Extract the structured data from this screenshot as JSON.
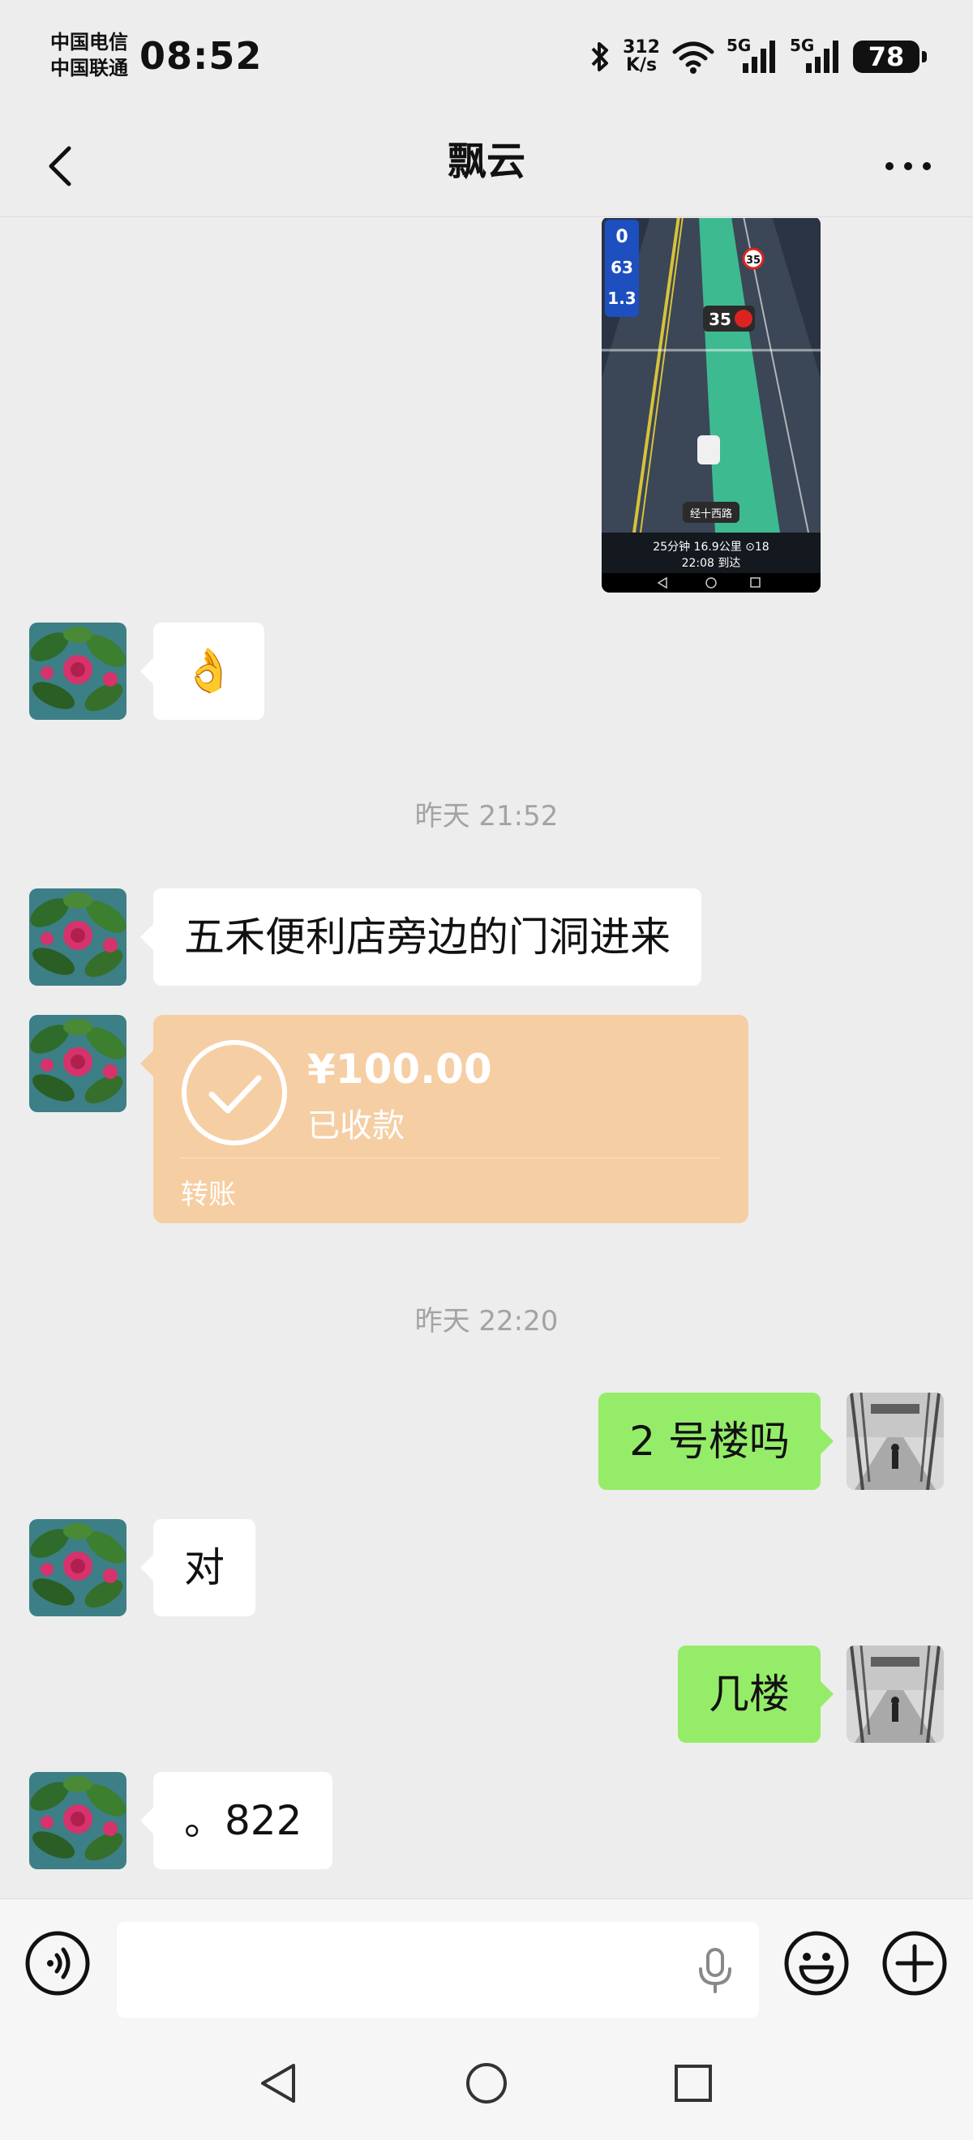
{
  "status_bar": {
    "carrier_1": "中国电信",
    "carrier_2": "中国联通",
    "time": "08:52",
    "net_speed_value": "312",
    "net_speed_unit": "K/s",
    "signal_1": "5G",
    "signal_2": "5G",
    "battery": "78"
  },
  "header": {
    "title": "飘云"
  },
  "shared_image": {
    "speed_now": "0",
    "speed_limit_1": "63",
    "distance_1": "1.3",
    "sign_35": "35",
    "lane_sign": "35",
    "road_name": "经十西路",
    "trip_summary": "25分钟  16.9公里  ⊙18",
    "arrival": "22:08 到达"
  },
  "messages": [
    {
      "side": "left",
      "type": "emoji",
      "text": "👌"
    },
    {
      "type": "timestamp",
      "text": "昨天 21:52"
    },
    {
      "side": "left",
      "type": "text",
      "text": "五禾便利店旁边的门洞进来"
    },
    {
      "side": "left",
      "type": "transfer",
      "amount": "¥100.00",
      "status": "已收款",
      "label": "转账"
    },
    {
      "type": "timestamp",
      "text": "昨天 22:20"
    },
    {
      "side": "right",
      "type": "text",
      "text": "2 号楼吗"
    },
    {
      "side": "left",
      "type": "text",
      "text": "对"
    },
    {
      "side": "right",
      "type": "text",
      "text": "几楼"
    },
    {
      "side": "left",
      "type": "text",
      "text": "。822"
    }
  ],
  "input": {
    "value": "",
    "placeholder": ""
  },
  "icons": {
    "back": "chevron-left-icon",
    "more": "more-dots-icon",
    "voice": "voice-toggle-icon",
    "mic": "microphone-icon",
    "emoji": "emoji-icon",
    "plus": "plus-icon"
  },
  "colors": {
    "background": "#ededed",
    "my_bubble": "#95ec69",
    "their_bubble": "#ffffff",
    "transfer_card": "#f6cea3",
    "timestamp_text": "#a3a3a3"
  }
}
